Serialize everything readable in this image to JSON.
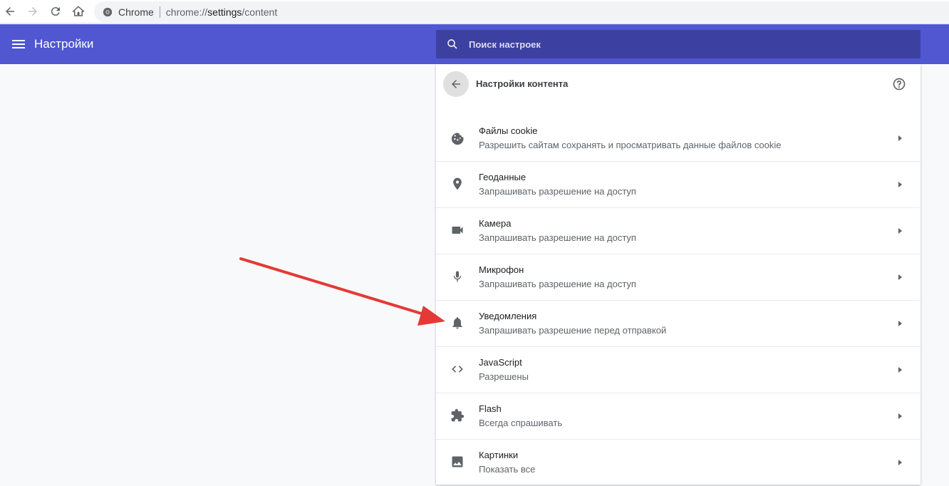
{
  "browser": {
    "site_name": "Chrome",
    "url_scheme": "chrome://",
    "url_host": "settings",
    "url_path": "/content"
  },
  "header": {
    "title": "Настройки",
    "search_placeholder": "Поиск настроек"
  },
  "subpage": {
    "title": "Настройки контента"
  },
  "items": [
    {
      "title": "Файлы cookie",
      "subtitle": "Разрешить сайтам сохранять и просматривать данные файлов cookie",
      "icon": "cookie-icon"
    },
    {
      "title": "Геоданные",
      "subtitle": "Запрашивать разрешение на доступ",
      "icon": "location-icon"
    },
    {
      "title": "Камера",
      "subtitle": "Запрашивать разрешение на доступ",
      "icon": "camera-icon"
    },
    {
      "title": "Микрофон",
      "subtitle": "Запрашивать разрешение на доступ",
      "icon": "microphone-icon"
    },
    {
      "title": "Уведомления",
      "subtitle": "Запрашивать разрешение перед отправкой",
      "icon": "bell-icon"
    },
    {
      "title": "JavaScript",
      "subtitle": "Разрешены",
      "icon": "code-icon"
    },
    {
      "title": "Flash",
      "subtitle": "Всегда спрашивать",
      "icon": "puzzle-icon"
    },
    {
      "title": "Картинки",
      "subtitle": "Показать все",
      "icon": "image-icon"
    }
  ],
  "colors": {
    "header_bg": "#5157d0",
    "search_bg": "#3c40a0",
    "annotation_arrow": "#e53935"
  }
}
